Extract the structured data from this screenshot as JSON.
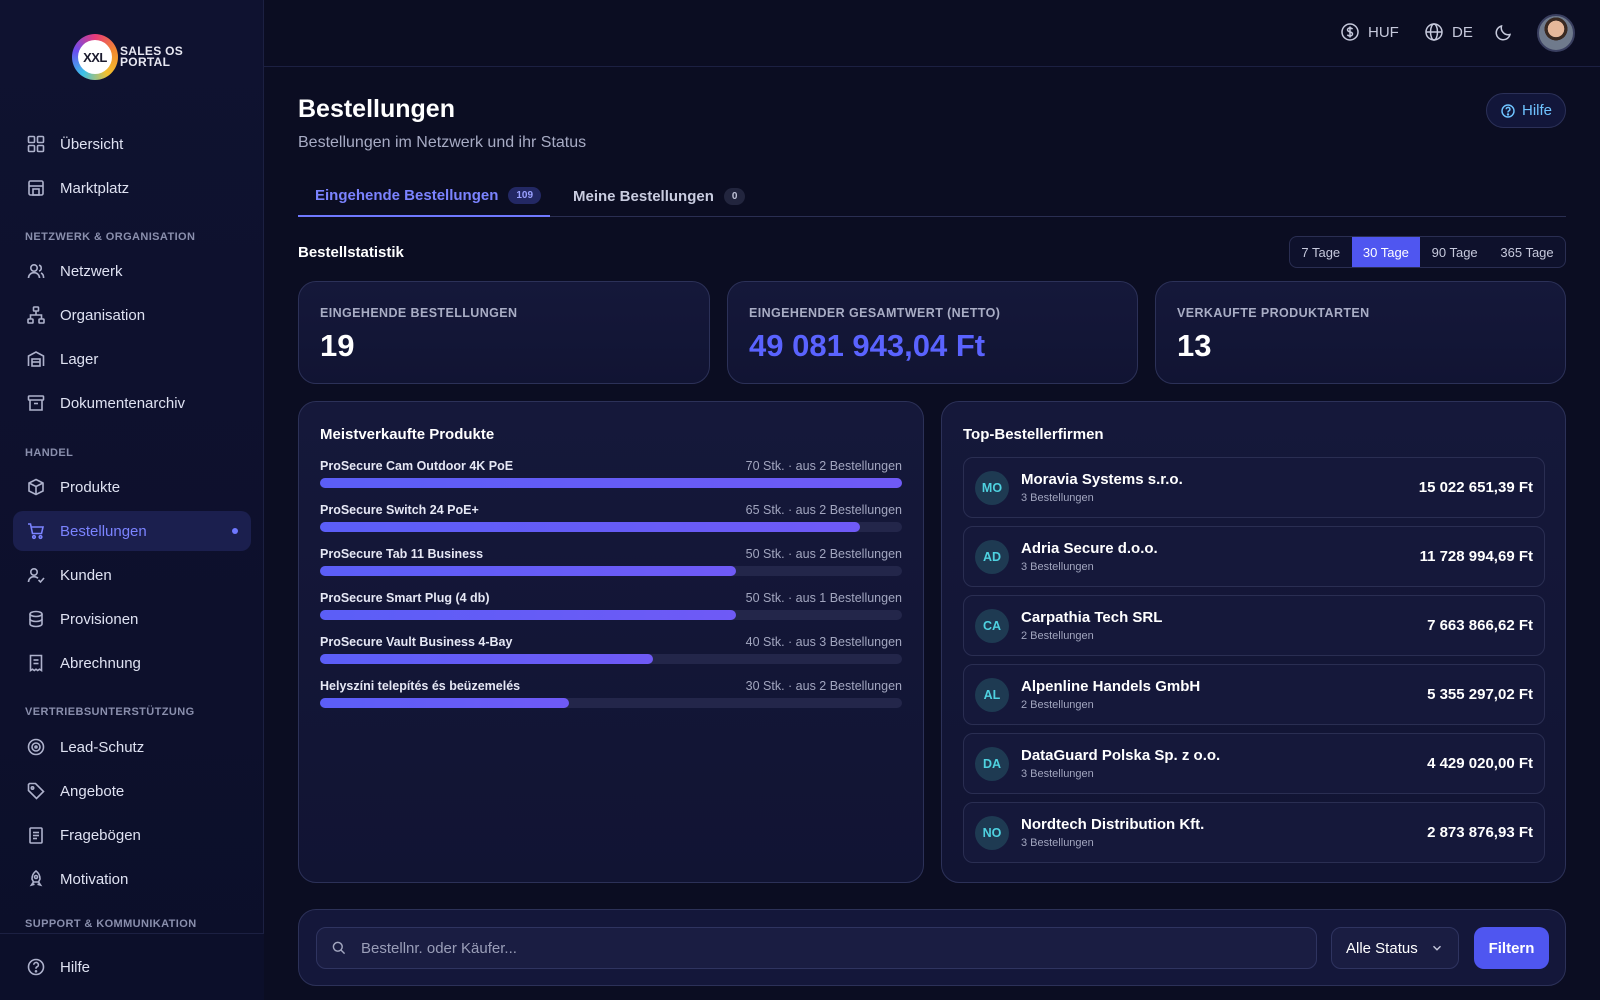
{
  "app": {
    "logo_mark": "XXL",
    "logo_text": "SALES OS PORTAL"
  },
  "topbar": {
    "currency": "HUF",
    "language": "DE"
  },
  "sidebar": {
    "items": [
      {
        "label": "Übersicht",
        "icon": "grid-icon"
      },
      {
        "label": "Marktplatz",
        "icon": "store-icon"
      },
      {
        "label": "Netzwerk",
        "icon": "users-icon"
      },
      {
        "label": "Organisation",
        "icon": "org-chart-icon"
      },
      {
        "label": "Lager",
        "icon": "warehouse-icon"
      },
      {
        "label": "Dokumentenarchiv",
        "icon": "archive-icon"
      },
      {
        "label": "Produkte",
        "icon": "box-icon"
      },
      {
        "label": "Bestellungen",
        "icon": "cart-icon"
      },
      {
        "label": "Kunden",
        "icon": "user-check-icon"
      },
      {
        "label": "Provisionen",
        "icon": "coins-icon"
      },
      {
        "label": "Abrechnung",
        "icon": "receipt-icon"
      },
      {
        "label": "Lead-Schutz",
        "icon": "target-icon"
      },
      {
        "label": "Angebote",
        "icon": "tag-icon"
      },
      {
        "label": "Fragebögen",
        "icon": "clipboard-icon"
      },
      {
        "label": "Motivation",
        "icon": "rocket-icon"
      }
    ],
    "sections": [
      "NETZWERK & ORGANISATION",
      "HANDEL",
      "VERTRIEBSUNTERSTÜTZUNG",
      "SUPPORT & KOMMUNIKATION"
    ],
    "bottom_item": "Hilfe"
  },
  "page": {
    "title": "Bestellungen",
    "subtitle": "Bestellungen im Netzwerk und ihr Status",
    "help_label": "Hilfe"
  },
  "tabs": [
    {
      "label": "Eingehende Bestellungen",
      "badge": "109"
    },
    {
      "label": "Meine Bestellungen",
      "badge": "0"
    }
  ],
  "stats": {
    "title": "Bestellstatistik",
    "ranges": [
      "7 Tage",
      "30 Tage",
      "90 Tage",
      "365 Tage"
    ],
    "selected_range": "30 Tage",
    "kpis": [
      {
        "label": "EINGEHENDE BESTELLUNGEN",
        "value": "19"
      },
      {
        "label": "EINGEHENDER GESAMTWERT (NETTO)",
        "value": "49 081 943,04 Ft"
      },
      {
        "label": "VERKAUFTE PRODUKTARTEN",
        "value": "13"
      }
    ]
  },
  "top_products": {
    "title": "Meistverkaufte Produkte",
    "max_qty": 70,
    "items": [
      {
        "name": "ProSecure Cam Outdoor 4K PoE",
        "meta": "70 Stk. · aus 2 Bestellungen",
        "qty": 70
      },
      {
        "name": "ProSecure Switch 24 PoE+",
        "meta": "65 Stk. · aus 2 Bestellungen",
        "qty": 65
      },
      {
        "name": "ProSecure Tab 11 Business",
        "meta": "50 Stk. · aus 2 Bestellungen",
        "qty": 50
      },
      {
        "name": "ProSecure Smart Plug (4 db)",
        "meta": "50 Stk. · aus 1 Bestellungen",
        "qty": 50
      },
      {
        "name": "ProSecure Vault Business 4-Bay",
        "meta": "40 Stk. · aus 3 Bestellungen",
        "qty": 40
      },
      {
        "name": "Helyszíni telepítés és beüzemelés",
        "meta": "30 Stk. · aus 2 Bestellungen",
        "qty": 30
      }
    ]
  },
  "top_buyers": {
    "title": "Top-Bestellerfirmen",
    "items": [
      {
        "initials": "MO",
        "name": "Moravia Systems s.r.o.",
        "count": "3 Bestellungen",
        "amount": "15 022 651,39 Ft"
      },
      {
        "initials": "AD",
        "name": "Adria Secure d.o.o.",
        "count": "3 Bestellungen",
        "amount": "11 728 994,69 Ft"
      },
      {
        "initials": "CA",
        "name": "Carpathia Tech SRL",
        "count": "2 Bestellungen",
        "amount": "7 663 866,62 Ft"
      },
      {
        "initials": "AL",
        "name": "Alpenline Handels GmbH",
        "count": "2 Bestellungen",
        "amount": "5 355 297,02 Ft"
      },
      {
        "initials": "DA",
        "name": "DataGuard Polska Sp. z o.o.",
        "count": "3 Bestellungen",
        "amount": "4 429 020,00 Ft"
      },
      {
        "initials": "NO",
        "name": "Nordtech Distribution Kft.",
        "count": "3 Bestellungen",
        "amount": "2 873 876,93 Ft"
      }
    ]
  },
  "filters": {
    "search_placeholder": "Bestellnr. oder Käufer...",
    "search_value": "",
    "status_selected": "Alle Status",
    "filter_button": "Filtern"
  },
  "colors": {
    "accent": "#4f56f0",
    "accent_text": "#7b83ff",
    "background": "#0b0d22"
  }
}
